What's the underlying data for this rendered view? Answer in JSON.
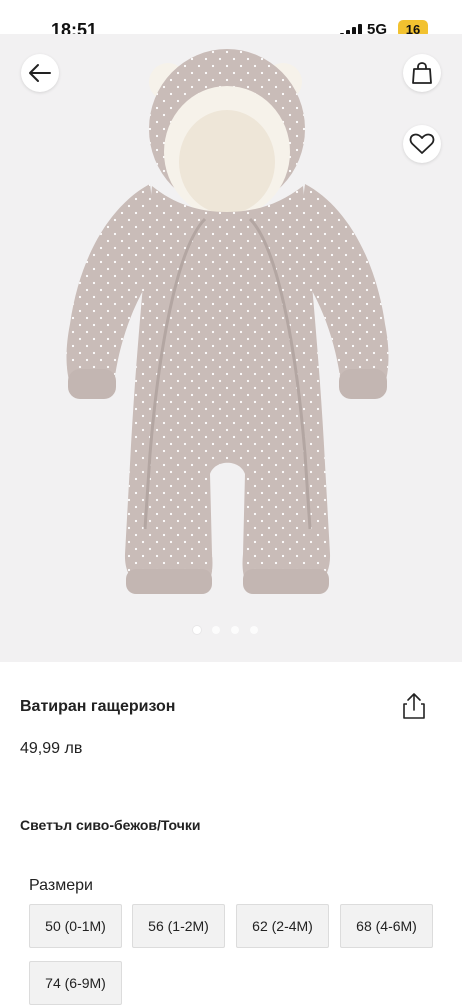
{
  "status_bar": {
    "time": "18:51",
    "network": "5G",
    "battery": "16"
  },
  "nav": {
    "back_icon": "arrow-left-icon",
    "bag_icon": "shopping-bag-icon",
    "favorite_icon": "heart-icon"
  },
  "carousel": {
    "dot_count": 4,
    "active_index": 0
  },
  "product": {
    "title": "Ватиран гащеризон",
    "price": "49,99 лв",
    "color": "Светъл сиво-бежов/Точки",
    "sizes_label": "Размери",
    "sizes": [
      "50 (0-1M)",
      "56 (1-2M)",
      "62 (2-4M)",
      "68 (4-6M)",
      "74 (6-9M)"
    ]
  },
  "colors": {
    "product_beige": "#c9bcb8",
    "fur": "#f6f2ea",
    "battery": "#f2c230"
  }
}
